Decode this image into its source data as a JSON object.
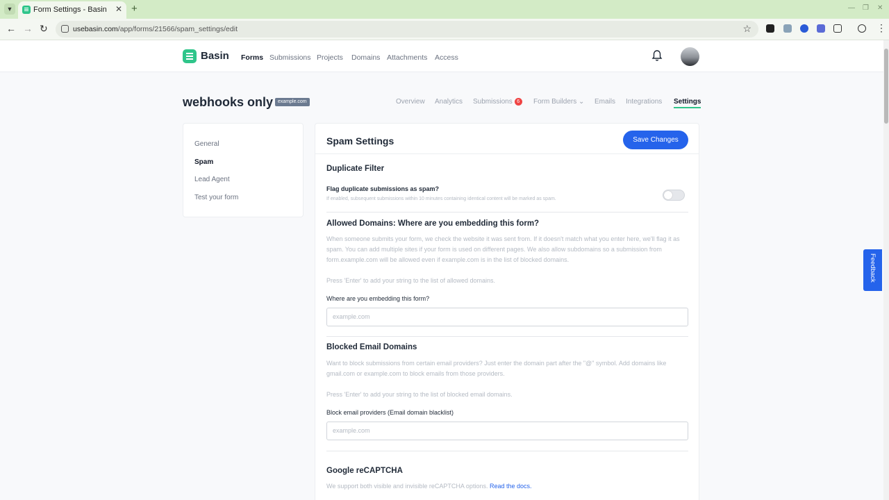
{
  "browser": {
    "tab_title": "Form Settings - Basin",
    "url_host": "usebasin.com",
    "url_path": "/app/forms/21566/spam_settings/edit"
  },
  "app": {
    "logo_text": "Basin",
    "nav": [
      "Forms",
      "Submissions",
      "Projects",
      "Domains",
      "Attachments",
      "Access"
    ],
    "active_nav": "Forms"
  },
  "form": {
    "title": "webhooks only",
    "badge": "example.com"
  },
  "subnav": {
    "overview": "Overview",
    "analytics": "Analytics",
    "submissions": "Submissions",
    "submissions_count": "6",
    "form_builders": "Form Builders",
    "emails": "Emails",
    "integrations": "Integrations",
    "settings": "Settings"
  },
  "sidemenu": [
    "General",
    "Spam",
    "Lead Agent",
    "Test your form"
  ],
  "sidemenu_active": "Spam",
  "spam": {
    "title": "Spam Settings",
    "save_label": "Save Changes",
    "duplicate": {
      "heading": "Duplicate Filter",
      "label": "Flag duplicate submissions as spam?",
      "help": "If enabled, subsequent submissions within 10 minutes containing identical content will be marked as spam.",
      "enabled": false
    },
    "allowed": {
      "heading": "Allowed Domains: Where are you embedding this form?",
      "desc": "When someone submits your form, we check the website it was sent from. If it doesn't match what you enter here, we'll flag it as spam. You can add multiple sites if your form is used on different pages. We also allow subdomains so a submission from form.example.com will be allowed even if example.com is in the list of blocked domains.",
      "hint": "Press 'Enter' to add your string to the list of allowed domains.",
      "field_label": "Where are you embedding this form?",
      "placeholder": "example.com"
    },
    "blocked": {
      "heading": "Blocked Email Domains",
      "desc": "Want to block submissions from certain email providers? Just enter the domain part after the \"@\" symbol. Add domains like gmail.com or example.com to block emails from those providers.",
      "hint": "Press 'Enter' to add your string to the list of blocked email domains.",
      "field_label": "Block email providers (Email domain blacklist)",
      "placeholder": "example.com"
    },
    "recaptcha": {
      "heading": "Google reCAPTCHA",
      "desc": "We support both visible and invisible reCAPTCHA options.",
      "link": "Read the docs."
    }
  },
  "feedback_label": "Feedback",
  "colors": {
    "brand": "#2fc58a",
    "primary": "#2563eb",
    "badge_red": "#ef4444"
  }
}
